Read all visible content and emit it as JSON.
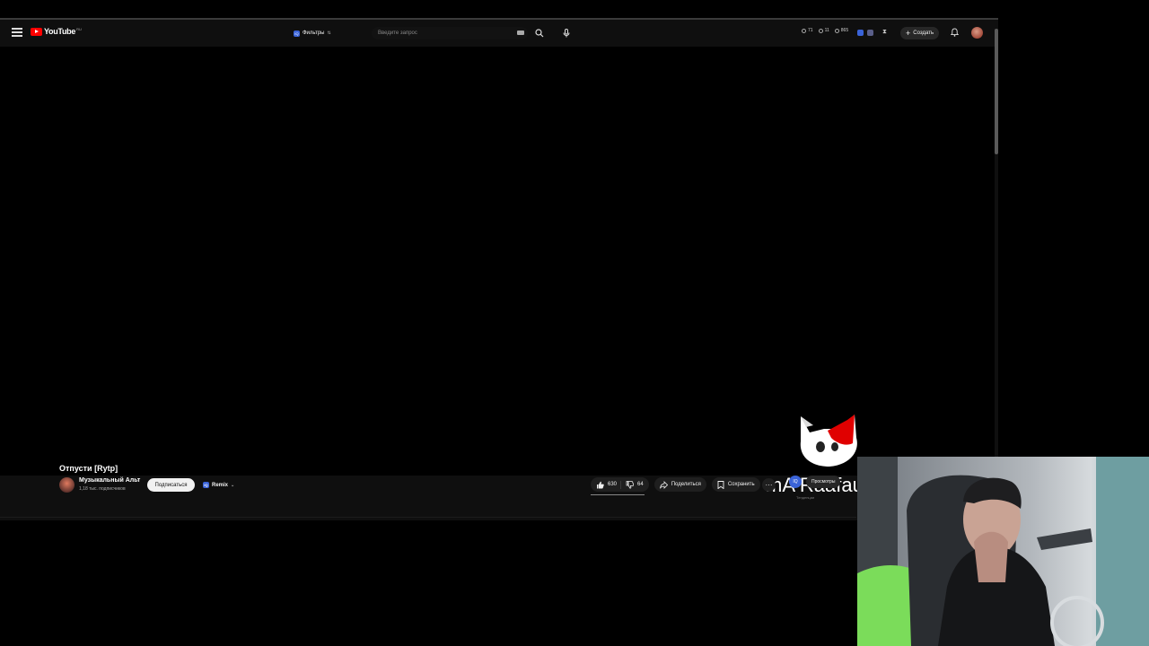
{
  "masthead": {
    "logo_text": "YouTube",
    "logo_superscript": "RU",
    "filter_label": "Фильтры",
    "filter_badge": "IQ",
    "search_placeholder": "Введите запрос",
    "stats": [
      "71",
      "11",
      "865"
    ],
    "create_label": "Создать"
  },
  "player": {
    "watermark_text": "mA Raafau"
  },
  "video": {
    "title": "Отпусти [Rytp]",
    "channel_name": "Музыкальный Альт",
    "subscribers": "1,18 тыс. подписчиков",
    "subscribe_label": "Подписаться",
    "remix_label": "Remix",
    "remix_badge": "IQ",
    "likes": "630",
    "dislikes": "64",
    "share_label": "Поделиться",
    "save_label": "Сохранить",
    "more_label": "···"
  },
  "sidebar": {
    "badge": "IQ",
    "views_chip": "Просмотры",
    "trending_label": "Тенденции"
  },
  "colors": {
    "background": "#0f0f0f",
    "brand_red": "#ff0000",
    "accent_blue": "#3a63d8"
  }
}
